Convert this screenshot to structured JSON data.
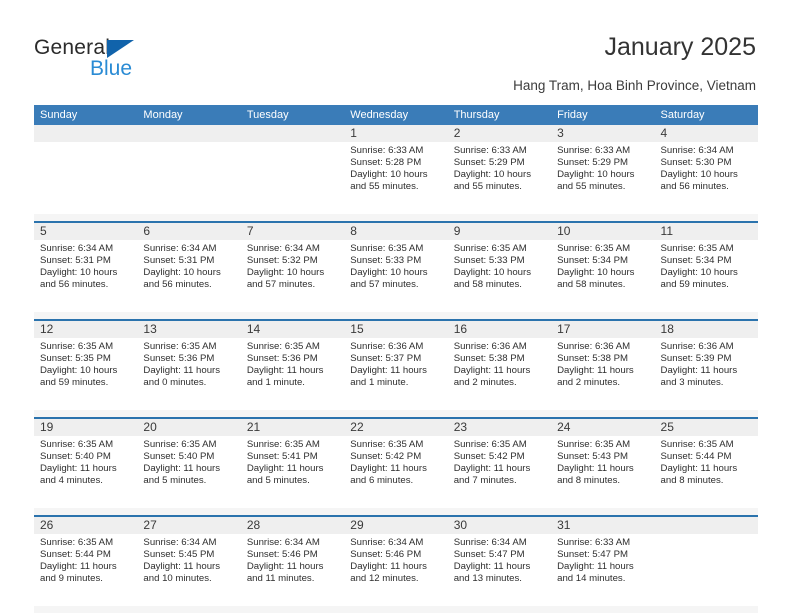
{
  "brand": {
    "name_part1": "General",
    "name_part2": "Blue",
    "triangle_color": "#1163ab",
    "blue_color": "#2a8bd4"
  },
  "header": {
    "title": "January 2025",
    "subtitle": "Hang Tram, Hoa Binh Province, Vietnam",
    "header_bg": "#3a7cb8"
  },
  "calendar": {
    "weekday_headers": [
      "Sunday",
      "Monday",
      "Tuesday",
      "Wednesday",
      "Thursday",
      "Friday",
      "Saturday"
    ],
    "weeks": [
      [
        {
          "day": "",
          "sunrise": "",
          "sunset": "",
          "daylight": ""
        },
        {
          "day": "",
          "sunrise": "",
          "sunset": "",
          "daylight": ""
        },
        {
          "day": "",
          "sunrise": "",
          "sunset": "",
          "daylight": ""
        },
        {
          "day": "1",
          "sunrise": "Sunrise: 6:33 AM",
          "sunset": "Sunset: 5:28 PM",
          "daylight": "Daylight: 10 hours and 55 minutes."
        },
        {
          "day": "2",
          "sunrise": "Sunrise: 6:33 AM",
          "sunset": "Sunset: 5:29 PM",
          "daylight": "Daylight: 10 hours and 55 minutes."
        },
        {
          "day": "3",
          "sunrise": "Sunrise: 6:33 AM",
          "sunset": "Sunset: 5:29 PM",
          "daylight": "Daylight: 10 hours and 55 minutes."
        },
        {
          "day": "4",
          "sunrise": "Sunrise: 6:34 AM",
          "sunset": "Sunset: 5:30 PM",
          "daylight": "Daylight: 10 hours and 56 minutes."
        }
      ],
      [
        {
          "day": "5",
          "sunrise": "Sunrise: 6:34 AM",
          "sunset": "Sunset: 5:31 PM",
          "daylight": "Daylight: 10 hours and 56 minutes."
        },
        {
          "day": "6",
          "sunrise": "Sunrise: 6:34 AM",
          "sunset": "Sunset: 5:31 PM",
          "daylight": "Daylight: 10 hours and 56 minutes."
        },
        {
          "day": "7",
          "sunrise": "Sunrise: 6:34 AM",
          "sunset": "Sunset: 5:32 PM",
          "daylight": "Daylight: 10 hours and 57 minutes."
        },
        {
          "day": "8",
          "sunrise": "Sunrise: 6:35 AM",
          "sunset": "Sunset: 5:33 PM",
          "daylight": "Daylight: 10 hours and 57 minutes."
        },
        {
          "day": "9",
          "sunrise": "Sunrise: 6:35 AM",
          "sunset": "Sunset: 5:33 PM",
          "daylight": "Daylight: 10 hours and 58 minutes."
        },
        {
          "day": "10",
          "sunrise": "Sunrise: 6:35 AM",
          "sunset": "Sunset: 5:34 PM",
          "daylight": "Daylight: 10 hours and 58 minutes."
        },
        {
          "day": "11",
          "sunrise": "Sunrise: 6:35 AM",
          "sunset": "Sunset: 5:34 PM",
          "daylight": "Daylight: 10 hours and 59 minutes."
        }
      ],
      [
        {
          "day": "12",
          "sunrise": "Sunrise: 6:35 AM",
          "sunset": "Sunset: 5:35 PM",
          "daylight": "Daylight: 10 hours and 59 minutes."
        },
        {
          "day": "13",
          "sunrise": "Sunrise: 6:35 AM",
          "sunset": "Sunset: 5:36 PM",
          "daylight": "Daylight: 11 hours and 0 minutes."
        },
        {
          "day": "14",
          "sunrise": "Sunrise: 6:35 AM",
          "sunset": "Sunset: 5:36 PM",
          "daylight": "Daylight: 11 hours and 1 minute."
        },
        {
          "day": "15",
          "sunrise": "Sunrise: 6:36 AM",
          "sunset": "Sunset: 5:37 PM",
          "daylight": "Daylight: 11 hours and 1 minute."
        },
        {
          "day": "16",
          "sunrise": "Sunrise: 6:36 AM",
          "sunset": "Sunset: 5:38 PM",
          "daylight": "Daylight: 11 hours and 2 minutes."
        },
        {
          "day": "17",
          "sunrise": "Sunrise: 6:36 AM",
          "sunset": "Sunset: 5:38 PM",
          "daylight": "Daylight: 11 hours and 2 minutes."
        },
        {
          "day": "18",
          "sunrise": "Sunrise: 6:36 AM",
          "sunset": "Sunset: 5:39 PM",
          "daylight": "Daylight: 11 hours and 3 minutes."
        }
      ],
      [
        {
          "day": "19",
          "sunrise": "Sunrise: 6:35 AM",
          "sunset": "Sunset: 5:40 PM",
          "daylight": "Daylight: 11 hours and 4 minutes."
        },
        {
          "day": "20",
          "sunrise": "Sunrise: 6:35 AM",
          "sunset": "Sunset: 5:40 PM",
          "daylight": "Daylight: 11 hours and 5 minutes."
        },
        {
          "day": "21",
          "sunrise": "Sunrise: 6:35 AM",
          "sunset": "Sunset: 5:41 PM",
          "daylight": "Daylight: 11 hours and 5 minutes."
        },
        {
          "day": "22",
          "sunrise": "Sunrise: 6:35 AM",
          "sunset": "Sunset: 5:42 PM",
          "daylight": "Daylight: 11 hours and 6 minutes."
        },
        {
          "day": "23",
          "sunrise": "Sunrise: 6:35 AM",
          "sunset": "Sunset: 5:42 PM",
          "daylight": "Daylight: 11 hours and 7 minutes."
        },
        {
          "day": "24",
          "sunrise": "Sunrise: 6:35 AM",
          "sunset": "Sunset: 5:43 PM",
          "daylight": "Daylight: 11 hours and 8 minutes."
        },
        {
          "day": "25",
          "sunrise": "Sunrise: 6:35 AM",
          "sunset": "Sunset: 5:44 PM",
          "daylight": "Daylight: 11 hours and 8 minutes."
        }
      ],
      [
        {
          "day": "26",
          "sunrise": "Sunrise: 6:35 AM",
          "sunset": "Sunset: 5:44 PM",
          "daylight": "Daylight: 11 hours and 9 minutes."
        },
        {
          "day": "27",
          "sunrise": "Sunrise: 6:34 AM",
          "sunset": "Sunset: 5:45 PM",
          "daylight": "Daylight: 11 hours and 10 minutes."
        },
        {
          "day": "28",
          "sunrise": "Sunrise: 6:34 AM",
          "sunset": "Sunset: 5:46 PM",
          "daylight": "Daylight: 11 hours and 11 minutes."
        },
        {
          "day": "29",
          "sunrise": "Sunrise: 6:34 AM",
          "sunset": "Sunset: 5:46 PM",
          "daylight": "Daylight: 11 hours and 12 minutes."
        },
        {
          "day": "30",
          "sunrise": "Sunrise: 6:34 AM",
          "sunset": "Sunset: 5:47 PM",
          "daylight": "Daylight: 11 hours and 13 minutes."
        },
        {
          "day": "31",
          "sunrise": "Sunrise: 6:33 AM",
          "sunset": "Sunset: 5:47 PM",
          "daylight": "Daylight: 11 hours and 14 minutes."
        },
        {
          "day": "",
          "sunrise": "",
          "sunset": "",
          "daylight": ""
        }
      ]
    ]
  }
}
